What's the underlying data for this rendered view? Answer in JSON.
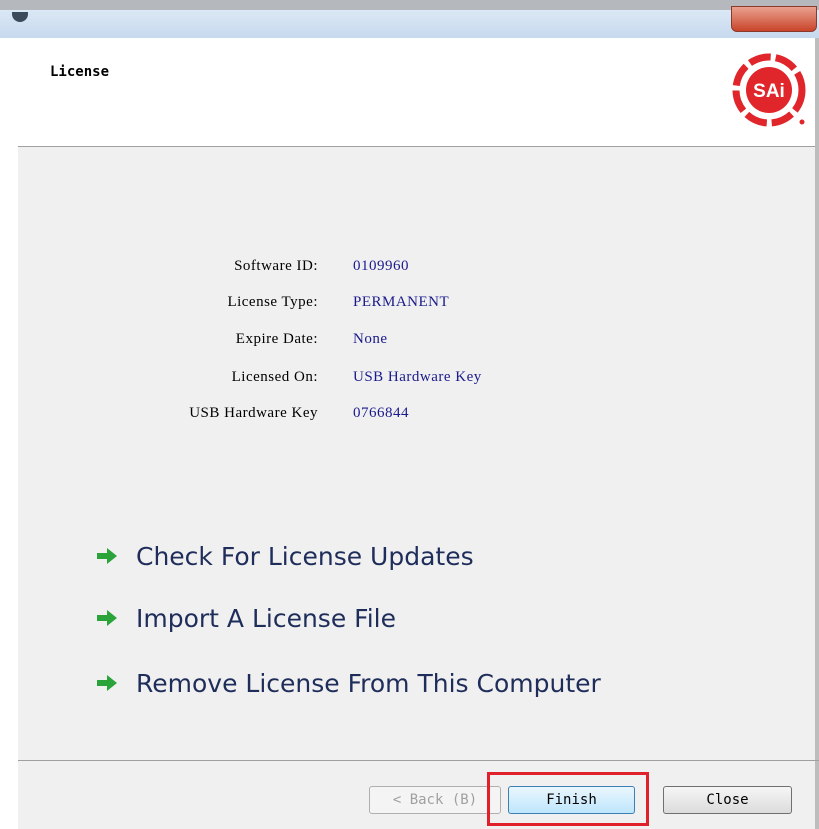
{
  "header": {
    "title": "License",
    "logo_text": "SAi"
  },
  "license_info": [
    {
      "label": "Software ID:",
      "value": "0109960"
    },
    {
      "label": "License Type:",
      "value": "PERMANENT"
    },
    {
      "label": "Expire Date:",
      "value": "None"
    },
    {
      "label": "Licensed On:",
      "value": "USB Hardware Key"
    },
    {
      "label": "USB Hardware Key",
      "value": "0766844"
    }
  ],
  "actions": [
    {
      "label": "Check For License Updates",
      "icon": "green-arrow-icon"
    },
    {
      "label": "Import A License File",
      "icon": "green-arrow-icon"
    },
    {
      "label": "Remove License From This Computer",
      "icon": "green-arrow-icon"
    }
  ],
  "buttons": {
    "back": "< Back (B)",
    "finish": "Finish",
    "close": "Close"
  },
  "colors": {
    "accent_red": "#e0202a",
    "value_text": "#1a1a8c",
    "arrow_green": "#2aa43a",
    "logo_red": "#e0262a"
  }
}
